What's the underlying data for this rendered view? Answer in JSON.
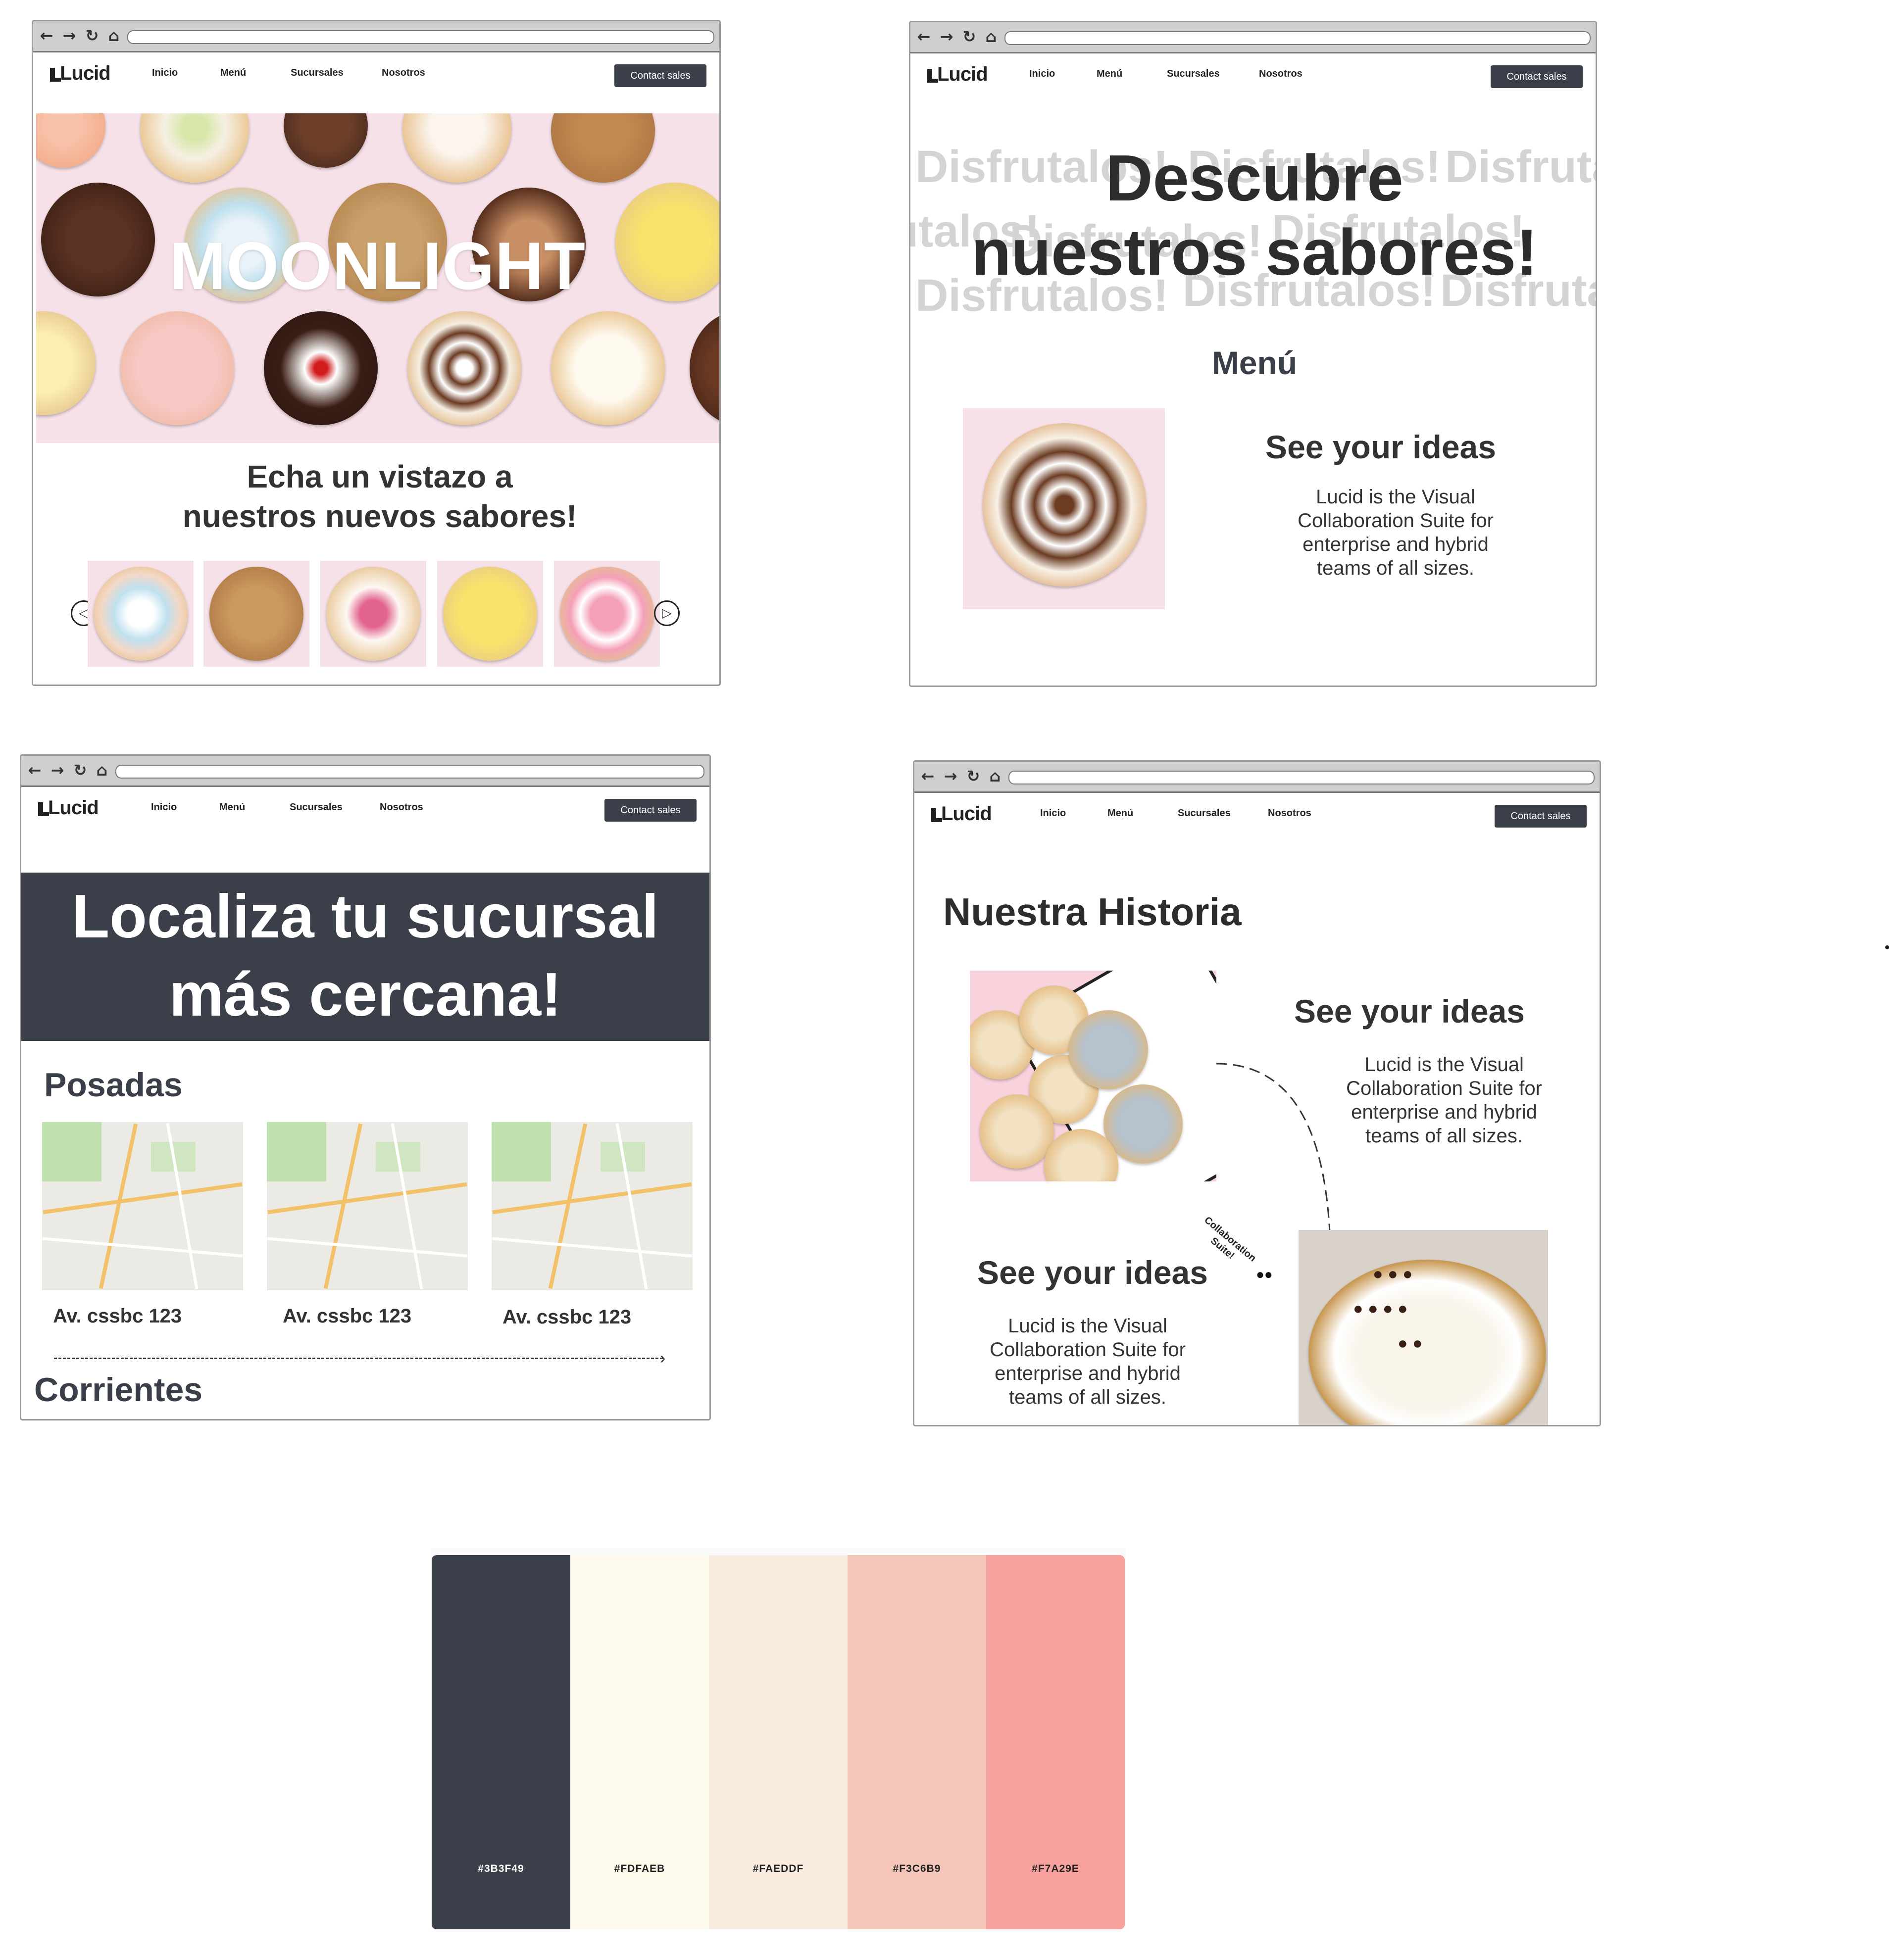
{
  "nav": {
    "logo": "Lucid",
    "links": [
      "Inicio",
      "Menú",
      "Sucursales",
      "Nosotros"
    ],
    "contact": "Contact sales"
  },
  "home": {
    "hero_title": "MOONLIGHT",
    "heading": "Echa un vistazo a nuestros nuevos sabores!"
  },
  "menu": {
    "hero_title": "Descubre nuestros sabores!",
    "bg_word": "Disfrutalos!",
    "section": "Menú",
    "card_title": "See your ideas",
    "card_text": "Lucid is the Visual Collaboration Suite for enterprise and hybrid teams of all sizes."
  },
  "branches": {
    "hero_title": "Localiza tu sucursal más cercana!",
    "region1": "Posadas",
    "addresses": [
      "Av. cssbc 123",
      "Av. cssbc 123",
      "Av. cssbc 123"
    ],
    "region2": "Corrientes"
  },
  "about": {
    "title": "Nuestra Historia",
    "block1_title": "See your ideas",
    "block1_text": "Lucid is the Visual Collaboration Suite for enterprise and hybrid teams of all sizes.",
    "block2_title": "See your ideas",
    "block2_text": "Lucid is the Visual Collaboration Suite for enterprise and hybrid teams of all sizes.",
    "sticker": "Collaboration Suite!"
  },
  "palette": {
    "colors": [
      "#3B3F49",
      "#FDFAEB",
      "#FAEDDF",
      "#F3C6B9",
      "#F7A29E"
    ]
  }
}
